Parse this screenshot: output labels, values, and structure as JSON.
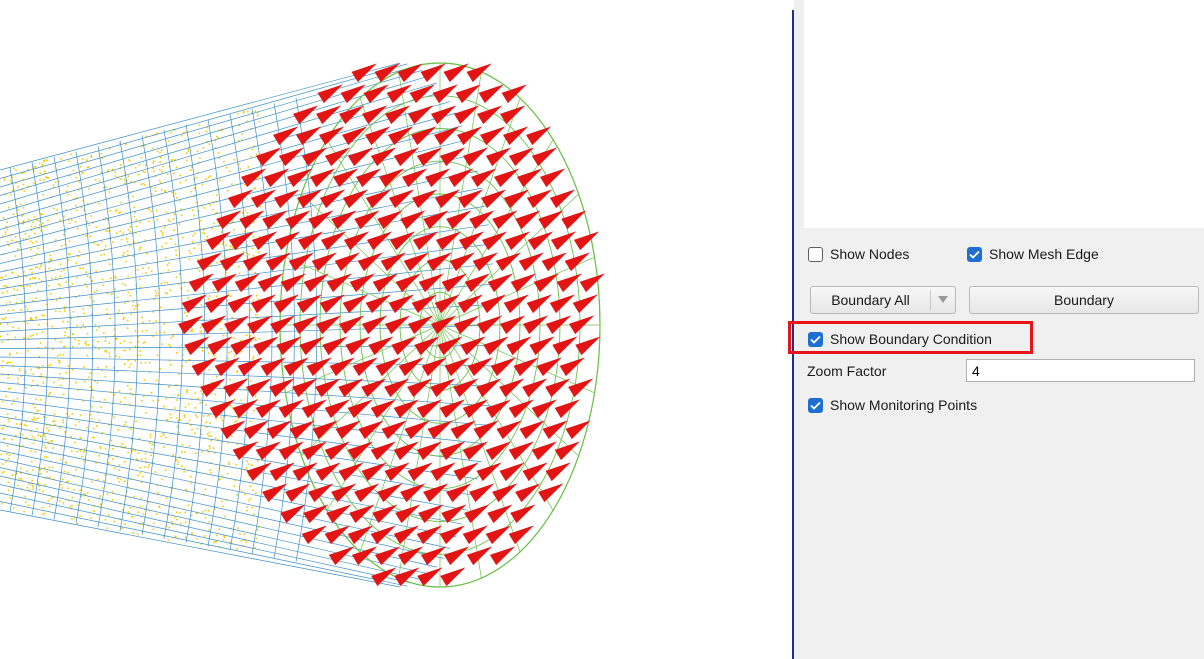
{
  "panel": {
    "show_nodes": {
      "label": "Show Nodes",
      "checked": false
    },
    "show_mesh_edge": {
      "label": "Show Mesh Edge",
      "checked": true
    },
    "boundary_combo": {
      "value": "Boundary All"
    },
    "boundary_button": {
      "label": "Boundary"
    },
    "show_boundary_condition": {
      "label": "Show Boundary Condition",
      "checked": true
    },
    "zoom_factor": {
      "label": "Zoom Factor",
      "value": "4"
    },
    "show_monitoring_points": {
      "label": "Show Monitoring Points",
      "checked": true
    }
  },
  "colors": {
    "arrow": "#e31414",
    "mesh_blue": "#3e8fc7",
    "mesh_green": "#6cc04a",
    "nodes_yellow": "#f2cc00",
    "checkbox_checked": "#1f6fd0",
    "highlight": "#e8141a",
    "splitter": "#1c2f8f"
  }
}
